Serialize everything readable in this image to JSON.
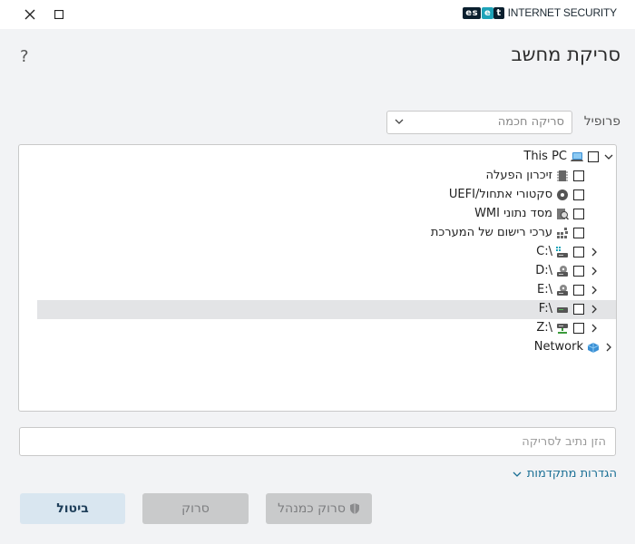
{
  "window": {
    "brand_logo": "eset",
    "brand_name": "INTERNET SECURITY",
    "controls": [
      "close-icon",
      "maximize-icon"
    ]
  },
  "header": {
    "title": "סריקת מחשב",
    "help": "?"
  },
  "profile": {
    "label": "פרופיל",
    "value": "סריקה חכמה"
  },
  "tree": {
    "root": "This PC",
    "items": [
      {
        "label": "זיכרון הפעלה",
        "icon": "memory-chip-icon"
      },
      {
        "label": "סקטורי אתחול/UEFI",
        "icon": "disc-icon"
      },
      {
        "label": "מסד נתוני WMI",
        "icon": "database-icon"
      },
      {
        "label": "ערכי רישום של המערכת",
        "icon": "registry-icon"
      },
      {
        "label": "C:\\",
        "icon": "system-drive-icon"
      },
      {
        "label": "D:\\",
        "icon": "cd-drive-icon"
      },
      {
        "label": "E:\\",
        "icon": "cd-drive-icon"
      },
      {
        "label": "F:\\",
        "icon": "removable-drive-icon"
      },
      {
        "label": "Z:\\",
        "icon": "network-drive-icon"
      }
    ],
    "network": "Network",
    "selected_index": 7
  },
  "path_input": {
    "placeholder": "הזן נתיב לסריקה",
    "value": ""
  },
  "advanced": {
    "label": "הגדרות מתקדמות"
  },
  "buttons": {
    "scan_as_admin": "סרוק כמנהל",
    "scan": "סרוק",
    "cancel": "ביטול"
  },
  "colors": {
    "accent": "#1a6f95",
    "brand_teal": "#1ea3b8",
    "disabled_button": "#c9cacb",
    "primary_button": "#d9e6f0",
    "selected_row": "#e3e4e6"
  }
}
